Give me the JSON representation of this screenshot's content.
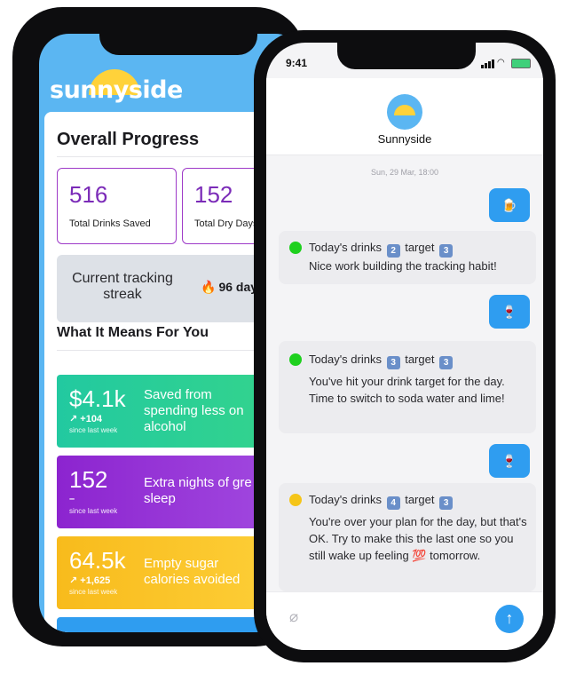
{
  "back_app": {
    "logo_text": "sunnyside",
    "overall_title": "Overall Progress",
    "stats": [
      {
        "value": "516",
        "label": "Total Drinks Saved"
      },
      {
        "value": "152",
        "label": "Total Dry Days A"
      }
    ],
    "streak": {
      "label": "Current tracking streak",
      "flame": "🔥",
      "value": "96 days"
    },
    "meaning_title": "What It Means For You",
    "impacts": [
      {
        "value": "$4.1k",
        "delta": "↗ +104",
        "since": "since last week",
        "label": "Saved from spending less on alcohol",
        "color": "#22c9a0"
      },
      {
        "value": "152",
        "delta": "–",
        "since": "since last week",
        "label": "Extra nights of gre sleep",
        "color": "#8c24cf"
      },
      {
        "value": "64.5k",
        "delta": "↗ +1,625",
        "since": "since last week",
        "label": "Empty sugar calories avoided",
        "color": "#f8bb1c"
      }
    ]
  },
  "front_app": {
    "status_time": "9:41",
    "contact_name": "Sunnyside",
    "date": "Sun, 29 Mar, 18:00",
    "messages": [
      {
        "type": "sent",
        "emoji": "🍺"
      },
      {
        "type": "received",
        "dot": "green",
        "prefix": "Today's drinks",
        "drinks": "2",
        "mid": "target",
        "target": "3",
        "body": "Nice work building the tracking habit!"
      },
      {
        "type": "sent",
        "emoji": "🍷"
      },
      {
        "type": "received",
        "dot": "green",
        "prefix": "Today's drinks",
        "drinks": "3",
        "mid": "target",
        "target": "3",
        "body": "You've hit your drink target for the day. Time to switch to soda water and lime!"
      },
      {
        "type": "sent",
        "emoji": "🍷"
      },
      {
        "type": "received",
        "dot": "yellow",
        "prefix": "Today's drinks",
        "drinks": "4",
        "mid": "target",
        "target": "3",
        "body": "You're over your plan for the day, but that's OK. Try to make this the last one so you still wake up feeling 💯 tomorrow."
      }
    ],
    "colors": {
      "accent": "#2f9df0",
      "green": "#1ed01e",
      "yellow": "#f5c518"
    }
  }
}
